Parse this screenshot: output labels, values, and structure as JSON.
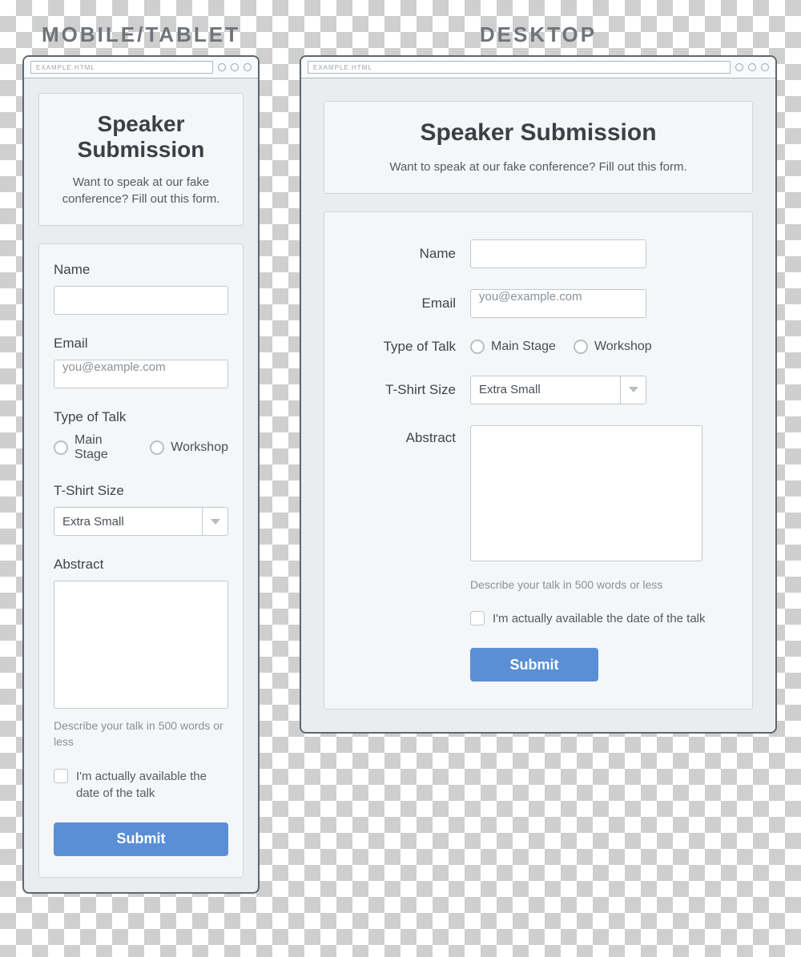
{
  "labels": {
    "mobile_title": "MOBILE/TABLET",
    "desktop_title": "DESKTOP"
  },
  "browser": {
    "url": "EXAMPLE.HTML"
  },
  "header": {
    "title": "Speaker Submission",
    "subtitle": "Want to speak at our fake conference? Fill out this form."
  },
  "form": {
    "name_label": "Name",
    "email_label": "Email",
    "email_placeholder": "you@example.com",
    "talk_type_label": "Type of Talk",
    "talk_options": {
      "main_stage": "Main Stage",
      "workshop": "Workshop"
    },
    "tshirt_label": "T-Shirt Size",
    "tshirt_selected": "Extra Small",
    "abstract_label": "Abstract",
    "abstract_hint": "Describe your talk in 500 words or less",
    "availability_label": "I'm actually available the date of the talk",
    "submit_label": "Submit"
  }
}
